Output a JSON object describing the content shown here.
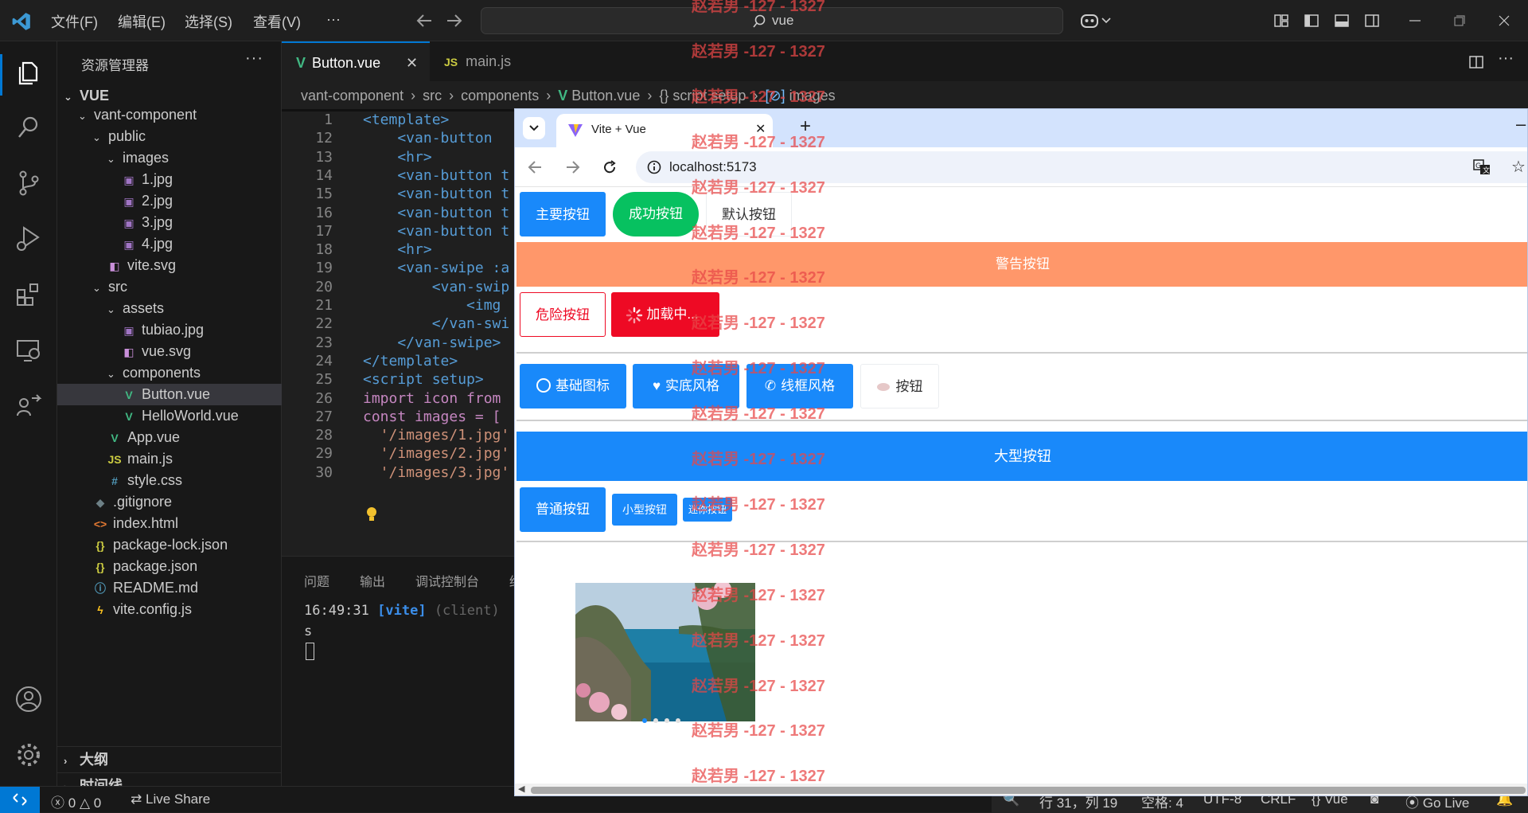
{
  "titlebar": {
    "menus": [
      "文件(F)",
      "编辑(E)",
      "选择(S)",
      "查看(V)",
      "···"
    ],
    "search": "vue"
  },
  "sidebar": {
    "title": "资源管理器",
    "root": "VUE",
    "tree": [
      {
        "label": "vant-component",
        "kind": "folder",
        "depth": 1
      },
      {
        "label": "public",
        "kind": "folder",
        "depth": 2
      },
      {
        "label": "images",
        "kind": "folder",
        "depth": 3
      },
      {
        "label": "1.jpg",
        "kind": "image",
        "depth": 4
      },
      {
        "label": "2.jpg",
        "kind": "image",
        "depth": 4
      },
      {
        "label": "3.jpg",
        "kind": "image",
        "depth": 4
      },
      {
        "label": "4.jpg",
        "kind": "image",
        "depth": 4
      },
      {
        "label": "vite.svg",
        "kind": "svg",
        "depth": 3
      },
      {
        "label": "src",
        "kind": "folder",
        "depth": 2
      },
      {
        "label": "assets",
        "kind": "folder",
        "depth": 3
      },
      {
        "label": "tubiao.jpg",
        "kind": "image",
        "depth": 4
      },
      {
        "label": "vue.svg",
        "kind": "svg",
        "depth": 4
      },
      {
        "label": "components",
        "kind": "folder",
        "depth": 3
      },
      {
        "label": "Button.vue",
        "kind": "vue",
        "depth": 4,
        "selected": true
      },
      {
        "label": "HelloWorld.vue",
        "kind": "vue",
        "depth": 4
      },
      {
        "label": "App.vue",
        "kind": "vue",
        "depth": 3
      },
      {
        "label": "main.js",
        "kind": "js",
        "depth": 3
      },
      {
        "label": "style.css",
        "kind": "css",
        "depth": 3
      },
      {
        "label": ".gitignore",
        "kind": "git",
        "depth": 2
      },
      {
        "label": "index.html",
        "kind": "html",
        "depth": 2
      },
      {
        "label": "package-lock.json",
        "kind": "json",
        "depth": 2
      },
      {
        "label": "package.json",
        "kind": "json",
        "depth": 2
      },
      {
        "label": "README.md",
        "kind": "info",
        "depth": 2
      },
      {
        "label": "vite.config.js",
        "kind": "vite",
        "depth": 2
      }
    ],
    "outline": "大纲",
    "timeline": "时间线"
  },
  "editor": {
    "tabs": [
      {
        "label": "Button.vue",
        "icon": "V",
        "active": true
      },
      {
        "label": "main.js",
        "icon": "JS",
        "active": false
      }
    ],
    "breadcrumb": [
      "vant-component",
      "src",
      "components",
      "Button.vue",
      "{} script setup",
      "images"
    ],
    "lines": [
      {
        "n": "1",
        "text": "<template>"
      },
      {
        "n": "12",
        "text": "    <van-button"
      },
      {
        "n": "13",
        "text": "    <hr>"
      },
      {
        "n": "14",
        "text": "    <van-button t"
      },
      {
        "n": "15",
        "text": "    <van-button t"
      },
      {
        "n": "16",
        "text": "    <van-button t"
      },
      {
        "n": "17",
        "text": "    <van-button t"
      },
      {
        "n": "18",
        "text": "    <hr>"
      },
      {
        "n": "19",
        "text": "    <van-swipe :a"
      },
      {
        "n": "20",
        "text": "        <van-swip"
      },
      {
        "n": "21",
        "text": "            <img"
      },
      {
        "n": "22",
        "text": "        </van-swi"
      },
      {
        "n": "23",
        "text": "    </van-swipe>"
      },
      {
        "n": "24",
        "text": "</template>"
      },
      {
        "n": "25",
        "text": "<script setup>"
      },
      {
        "n": "26",
        "text": "import icon from"
      },
      {
        "n": "27",
        "text": "const images = ["
      },
      {
        "n": "28",
        "text": "  '/images/1.jpg'"
      },
      {
        "n": "29",
        "text": "  '/images/2.jpg'"
      },
      {
        "n": "30",
        "text": "  '/images/3.jpg'"
      }
    ]
  },
  "panel": {
    "tabs": [
      "问题",
      "输出",
      "调试控制台",
      "终"
    ],
    "terminal_time": "16:49:31",
    "terminal_tag": "[vite]",
    "terminal_client": "(client)",
    "terminal_line2": "s"
  },
  "browser": {
    "tab_title": "Vite + Vue",
    "url": "localhost:5173",
    "buttons": {
      "primary": "主要按钮",
      "success": "成功按钮",
      "default": "默认按钮",
      "warning": "警告按钮",
      "danger": "危险按钮",
      "loading": "加载中...",
      "icon_basic": "基础图标",
      "icon_solid": "实底风格",
      "icon_outline": "线框风格",
      "icon_image": "按钮",
      "large": "大型按钮",
      "normal": "普通按钮",
      "small": "小型按钮",
      "mini": "迷你按钮"
    },
    "swipe": {
      "count": 4,
      "active": 1
    }
  },
  "watermark": "赵若男 -127 - 1327",
  "statusbar": {
    "errors": "0",
    "warnings": "0",
    "live_share": "Live Share",
    "position": "行 31，列 19",
    "spaces": "空格: 4",
    "encoding": "UTF-8",
    "eol": "CRLF",
    "language": "Vue",
    "golive": "Go Live"
  },
  "colors": {
    "primary": "#1989fa",
    "success": "#07c160",
    "warning": "#ff976a",
    "danger": "#ee0a24",
    "vue_green": "#41b883",
    "watermark": "#e84646"
  }
}
